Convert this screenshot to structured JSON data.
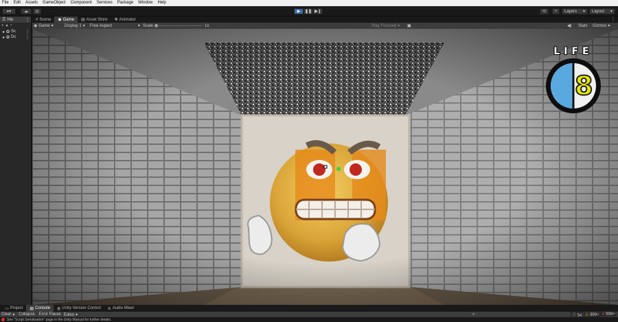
{
  "menu": [
    "File",
    "Edit",
    "Assets",
    "GameObject",
    "Component",
    "Services",
    "Package",
    "Window",
    "Help"
  ],
  "toolbar": {
    "account_label": "",
    "layers_label": "Layers",
    "layout_label": "Layout"
  },
  "hierarchy": {
    "tab_label": "Hie",
    "items": [
      "Sc",
      "Dc"
    ]
  },
  "tabs": [
    {
      "label": "Scene",
      "icon": "scene-icon"
    },
    {
      "label": "Game",
      "icon": "game-icon"
    },
    {
      "label": "Asset Store",
      "icon": "asset-store-icon"
    },
    {
      "label": "Animator",
      "icon": "animator-icon"
    }
  ],
  "game_bar": {
    "view_label": "Game",
    "display_label": "Display 1",
    "aspect_label": "Free Aspect",
    "scale_label": "Scale",
    "scale_value": "1x",
    "play_mode_label": "Play Focused",
    "stats_label": "Stats",
    "gizmos_label": "Gizmos"
  },
  "hud": {
    "title": "LIFE",
    "lives": "8",
    "fill_fraction": 0.5,
    "accent": "#5aa8e0"
  },
  "bottom_tabs": [
    "Project",
    "Console",
    "Unity Version Control",
    "Audio Mixer"
  ],
  "console_bar": {
    "clear": "Clear",
    "collapse": "Collapse",
    "error_pause": "Error Pause",
    "editor": "Editor"
  },
  "console_counts": {
    "logs": "54",
    "warnings": "999+",
    "errors": "999+"
  },
  "status_message": "See \"Script Serialization\" page in the Unity Manual for further details."
}
